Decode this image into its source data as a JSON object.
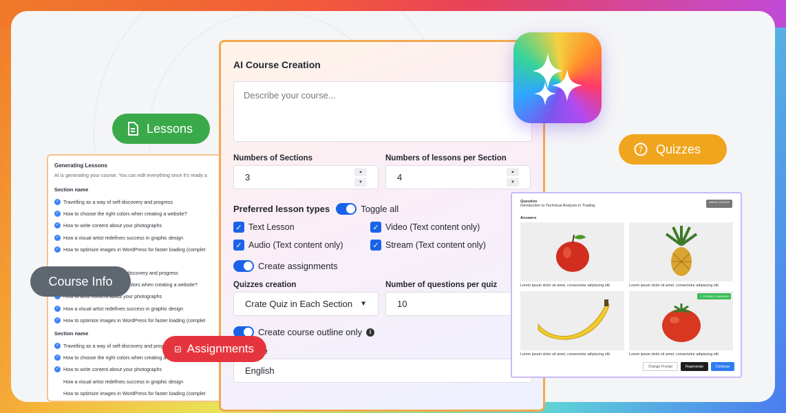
{
  "form": {
    "title": "AI Course Creation",
    "description_placeholder": "Describe your course...",
    "sections_label": "Numbers of Sections",
    "sections_value": "3",
    "lessons_label": "Numbers of lessons per Section",
    "lessons_value": "4",
    "lesson_types_label": "Preferred lesson types",
    "toggle_all_label": "Toggle all",
    "lesson_types": [
      "Text Lesson",
      "Video (Text content only)",
      "Audio (Text content only)",
      "Stream (Text content only)"
    ],
    "create_assignments_label": "Create assignments",
    "quizzes_label": "Quizzes creation",
    "quizzes_value": "Crate Quiz in Each Section",
    "questions_label": "Number of questions per quiz",
    "questions_value": "10",
    "outline_label": "Create course outline only",
    "language_label": "age",
    "language_value": "English"
  },
  "pills": {
    "lessons": "Lessons",
    "quizzes": "Quizzes",
    "course_info": "Course Info",
    "assignments": "Assignments"
  },
  "lessons_panel": {
    "title": "Generating Lessons",
    "subtitle": "AI is generating your course. You can edit everything once it's ready a",
    "section_label": "Section name",
    "items": [
      "Travelling as a way of self-discovery and progress",
      "How to choose the right colors when creating a website?",
      "How to write content about your photographs",
      "How a visual artist redefines success in graphic design",
      "How to optimize images in WordPress for faster loading (complet"
    ],
    "items_2": [
      "self-discovery and progress",
      "ight colors when creating a website?",
      "How to write content about your photographs",
      "How a visual artist redefines success in graphic design",
      "How to optimize images in WordPress for faster loading (complet"
    ]
  },
  "quiz_panel": {
    "question_label": "Question",
    "question_text": "Introduction to Technical Analysis in Trading",
    "badge": "IMAGE CHOICE",
    "answers_label": "Answers",
    "caption": "Lorem ipsum dolor sit amet, consectetur adipiscing elit.",
    "correct_label": "✓ CORRECT ANSWER",
    "buttons": {
      "change_prompt": "Change Prompt",
      "regenerate": "Regenerate",
      "continue": "Continue"
    }
  }
}
